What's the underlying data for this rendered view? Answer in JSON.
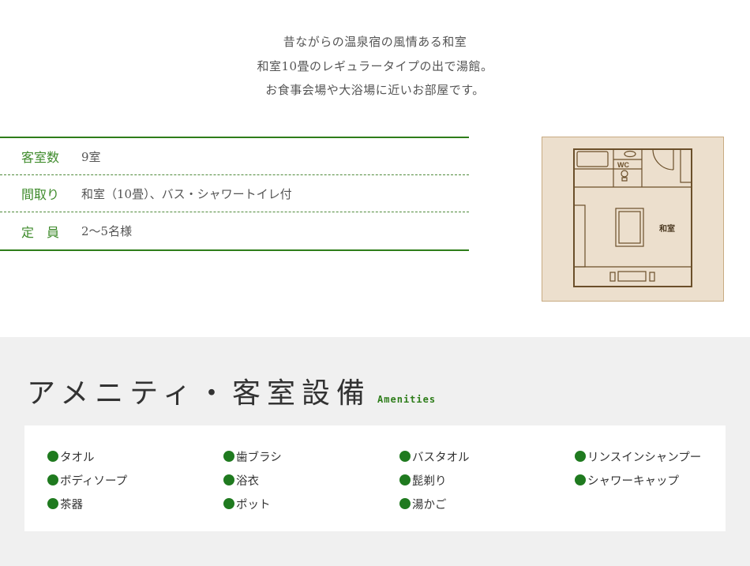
{
  "intro": {
    "lines": [
      "昔ながらの温泉宿の風情ある和室",
      "和室10畳のレギュラータイプの出で湯館。",
      "お食事会場や大浴場に近いお部屋です。"
    ]
  },
  "spec": {
    "rows": [
      {
        "label": "客室数",
        "value": "9室"
      },
      {
        "label": "間取り",
        "value": "和室（10畳）、バス・シャワートイレ付"
      },
      {
        "label": "定　員",
        "value": "2〜5名様"
      }
    ]
  },
  "floorplan": {
    "wc_label": "WC",
    "room_label": "和室"
  },
  "amenities": {
    "title": "アメニティ・客室設備",
    "title_en": "Amenities",
    "columns": [
      [
        "タオル",
        "ボディソープ",
        "茶器"
      ],
      [
        "歯ブラシ",
        "浴衣",
        "ポット"
      ],
      [
        "バスタオル",
        "髭剃り",
        "湯かご"
      ],
      [
        "リンスインシャンプー",
        "シャワーキャップ"
      ]
    ],
    "bullet_color": "#1f7a1f"
  },
  "colors": {
    "accent_green": "#2e7d1a",
    "plan_bg": "#ecdfcd",
    "plan_line": "#6b4f2a"
  }
}
